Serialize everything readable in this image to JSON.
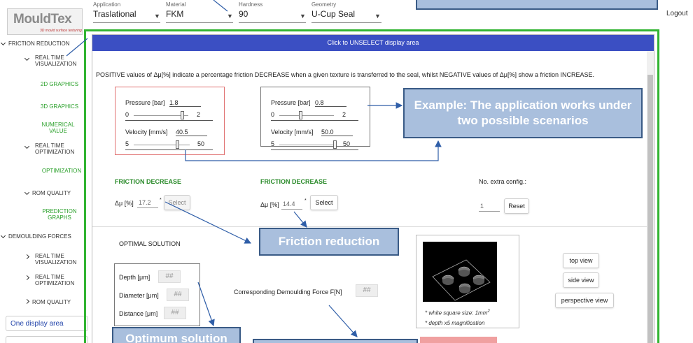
{
  "header": {
    "fields": [
      {
        "label": "Application",
        "value": "Traslational"
      },
      {
        "label": "Material",
        "value": "FKM"
      },
      {
        "label": "Hardness",
        "value": "90"
      },
      {
        "label": "Geometry",
        "value": "U-Cup Seal"
      }
    ],
    "logout": "Logout"
  },
  "logo": {
    "text": "MouldTex",
    "sub": "3D mould surface texturing"
  },
  "sidebar": {
    "items": [
      {
        "label": "FRICTION REDUCTION"
      },
      {
        "label": "REAL TIME VISUALIZATION"
      },
      {
        "label": "2D GRAPHICS"
      },
      {
        "label": "3D GRAPHICS"
      },
      {
        "label": "NUMERICAL VALUE"
      },
      {
        "label": "REAL TIME OPTIMIZATION"
      },
      {
        "label": "OPTIMIZATION"
      },
      {
        "label": "ROM QUALITY"
      },
      {
        "label": "PREDICTION GRAPHS"
      },
      {
        "label": "DEMOULDING FORCES"
      },
      {
        "label": "REAL TIME VISUALIZATION"
      },
      {
        "label": "REAL TIME OPTIMIZATION"
      },
      {
        "label": "ROM QUALITY"
      }
    ],
    "one_display_area": "One display area"
  },
  "main": {
    "unselect": "Click to UNSELECT display area",
    "info": "POSITIVE values of Δμ[%] indicate a percentage friction DECREASE when a given texture is transferred to the seal, whilst NEGATIVE values of Δμ[%] show a friction INCREASE.",
    "scenario1": {
      "pressure_label": "Pressure [bar]",
      "pressure": "1.8",
      "p_min": "0",
      "p_max": "2",
      "p_level": 0.9,
      "velocity_label": "Velocity [mm/s]",
      "velocity": "40.5",
      "v_min": "5",
      "v_max": "50",
      "v_level": 0.79
    },
    "scenario2": {
      "pressure_label": "Pressure [bar]",
      "pressure": "0.8",
      "p_min": "0",
      "p_max": "2",
      "p_level": 0.4,
      "velocity_label": "Velocity [mm/s]",
      "velocity": "50.0",
      "v_min": "5",
      "v_max": "50",
      "v_level": 1.0
    },
    "fd1": {
      "title": "FRICTION DECREASE",
      "mu_label": "Δμ [%]",
      "mu_value": "17.2",
      "select": "Select"
    },
    "fd2": {
      "title": "FRICTION DECREASE",
      "mu_label": "Δμ [%]",
      "mu_value": "14.4",
      "select": "Select"
    },
    "extra": {
      "label": "No. extra config.:",
      "value": "1",
      "reset": "Reset"
    },
    "optimal": {
      "title": "OPTIMAL SOLUTION",
      "depth": "Depth [μm]",
      "diameter": "Diameter [μm]",
      "distance": "Distance [μm]",
      "placeholder": "##"
    },
    "demoulding": {
      "label": "Corresponding Demoulding Force F[N]",
      "placeholder": "##"
    },
    "image": {
      "caption1": "* white square size: 1mm",
      "sup": "2",
      "caption2": "* depth x5 magnification"
    },
    "views": {
      "top": "top view",
      "side": "side view",
      "perspective": "perspective view"
    }
  },
  "callouts": {
    "top": "",
    "example": "Example: The application works under two possible scenarios",
    "friction": "Friction reduction",
    "optimum": "Optimum solution",
    "bottom": ""
  },
  "colors": {
    "green": "#31b431",
    "blue_bar": "#3b4fc3",
    "callout": "#a9bfdd"
  }
}
